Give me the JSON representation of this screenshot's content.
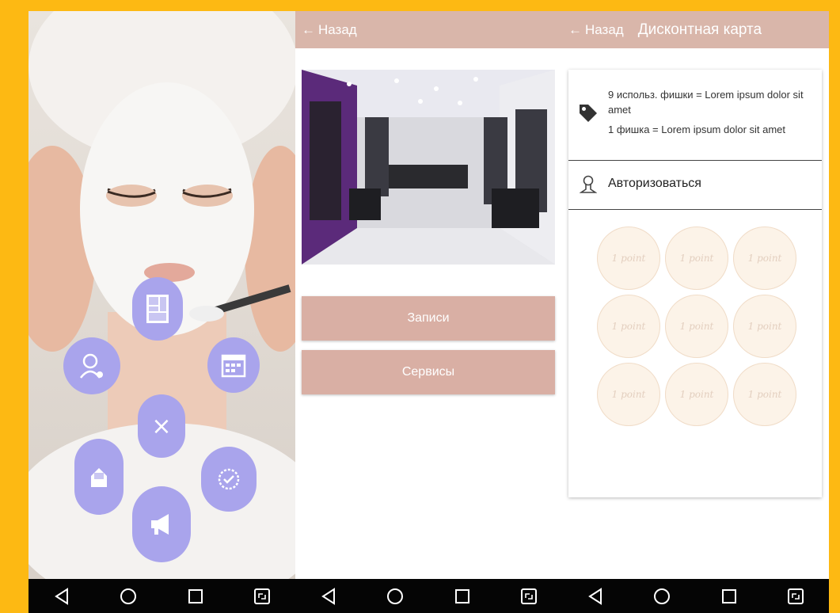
{
  "screen1": {
    "menu_icons": [
      "gallery-icon",
      "user-settings-icon",
      "calendar-icon",
      "close-icon",
      "mail-icon",
      "badge-icon",
      "megaphone-icon"
    ],
    "fab_color": "#A9A4EC",
    "close_glyph": "×"
  },
  "screen2": {
    "back_label": "Назад",
    "buttons": [
      "Записи",
      "Сервисы"
    ],
    "accent": "#D9B6AA"
  },
  "screen3": {
    "back_label": "Назад",
    "title": "Дисконтная карта",
    "info_lines": [
      "9 использ. фишки = Lorem ipsum dolor sit amet",
      "1 фишка = Lorem ipsum dolor sit amet"
    ],
    "auth_label": "Авторизоваться",
    "stamps": [
      "1 point",
      "1 point",
      "1 point",
      "1 point",
      "1 point",
      "1 point",
      "1 point",
      "1 point",
      "1 point"
    ]
  },
  "navbar": {
    "icons": [
      "back-triangle-icon",
      "home-circle-icon",
      "recents-square-icon",
      "screen-rotate-icon"
    ]
  }
}
